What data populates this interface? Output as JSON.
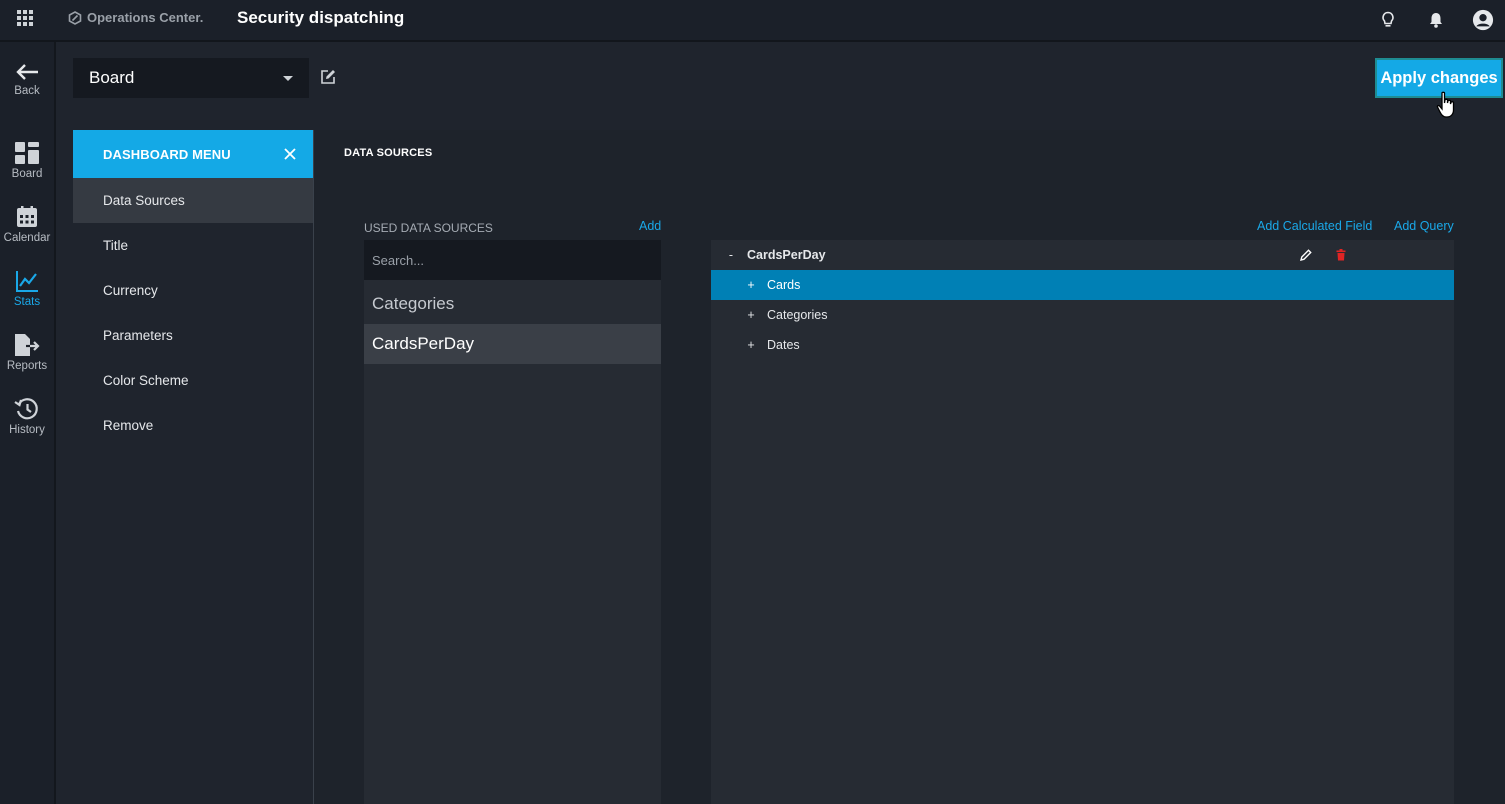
{
  "header": {
    "brand": "Operations Center.",
    "title": "Security dispatching"
  },
  "nav": {
    "items": [
      {
        "label": "Back",
        "icon": "arrow-left-icon"
      },
      {
        "label": "Board",
        "icon": "board-icon"
      },
      {
        "label": "Calendar",
        "icon": "calendar-icon"
      },
      {
        "label": "Stats",
        "icon": "stats-icon",
        "active": true
      },
      {
        "label": "Reports",
        "icon": "reports-icon"
      },
      {
        "label": "History",
        "icon": "history-icon"
      }
    ]
  },
  "board_select": {
    "value": "Board"
  },
  "apply_button": {
    "label": "Apply changes"
  },
  "menu": {
    "header": "DASHBOARD MENU",
    "items": [
      {
        "label": "Data Sources",
        "active": true
      },
      {
        "label": "Title"
      },
      {
        "label": "Currency"
      },
      {
        "label": "Parameters"
      },
      {
        "label": "Color Scheme"
      },
      {
        "label": "Remove"
      }
    ]
  },
  "data_sources": {
    "section_title": "DATA SOURCES",
    "used_label": "USED DATA SOURCES",
    "add_label": "Add",
    "add_calculated_label": "Add Calculated Field",
    "add_query_label": "Add Query",
    "search_placeholder": "Search...",
    "items": [
      {
        "label": "Categories"
      },
      {
        "label": "CardsPerDay",
        "selected": true
      }
    ],
    "tree": {
      "root": {
        "label": "CardsPerDay",
        "toggle": "-"
      },
      "children": [
        {
          "label": "Cards",
          "toggle": "+",
          "selected": true
        },
        {
          "label": "Categories",
          "toggle": "+"
        },
        {
          "label": "Dates",
          "toggle": "+"
        }
      ]
    }
  },
  "colors": {
    "accent": "#14a9e6",
    "selected_row": "#0080b5",
    "delete": "#e02424"
  }
}
